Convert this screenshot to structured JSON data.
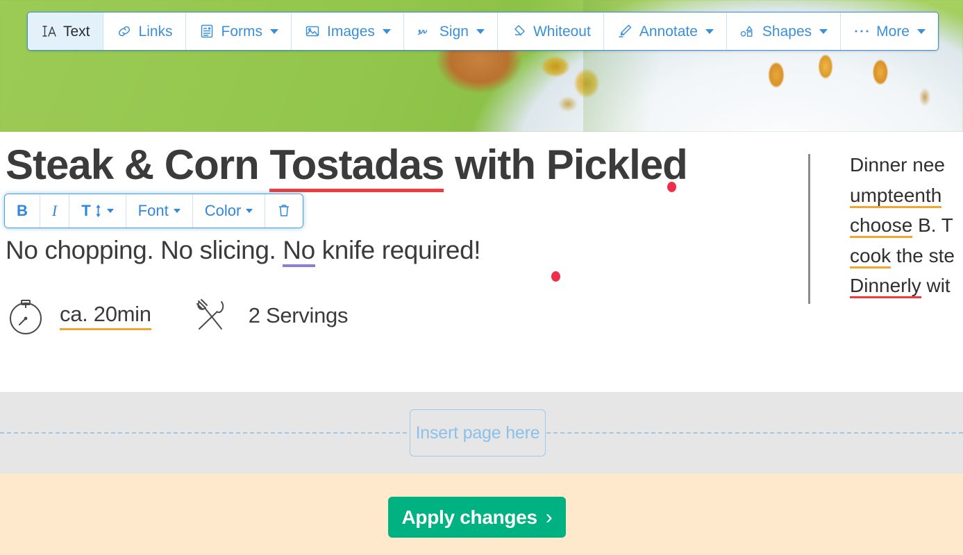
{
  "toolbar": {
    "items": [
      {
        "label": "Text",
        "icon": "text-cursor-icon",
        "active": true,
        "dropdown": false
      },
      {
        "label": "Links",
        "icon": "link-chain-icon",
        "active": false,
        "dropdown": false
      },
      {
        "label": "Forms",
        "icon": "form-clipboard-icon",
        "active": false,
        "dropdown": true
      },
      {
        "label": "Images",
        "icon": "image-picture-icon",
        "active": false,
        "dropdown": true
      },
      {
        "label": "Sign",
        "icon": "signature-icon",
        "active": false,
        "dropdown": true
      },
      {
        "label": "Whiteout",
        "icon": "eraser-icon",
        "active": false,
        "dropdown": false
      },
      {
        "label": "Annotate",
        "icon": "highlighter-pen-icon",
        "active": false,
        "dropdown": true
      },
      {
        "label": "Shapes",
        "icon": "shapes-icon",
        "active": false,
        "dropdown": true
      },
      {
        "label": "More",
        "icon": "ellipsis-icon",
        "active": false,
        "dropdown": true
      }
    ]
  },
  "format_toolbar": {
    "bold_label": "B",
    "italic_label": "I",
    "text_size_label": "T",
    "font_label": "Font",
    "color_label": "Color",
    "delete_icon": "trash-icon"
  },
  "document": {
    "title_part1": "Steak & Corn ",
    "title_misspelled": "Tostadas",
    "title_part2": " with Pickled",
    "subtitle_part1": "No chopping. No slicing. ",
    "subtitle_flagged": "No",
    "subtitle_part2": " knife required!",
    "meta": {
      "time_icon": "stopwatch-icon",
      "time_value": "ca. 20min",
      "servings_icon": "fork-knife-icon",
      "servings_value": "2 Servings"
    },
    "side_column": [
      {
        "plain_before": "Dinner nee",
        "flagged": "",
        "flag_color": "",
        "plain_after": ""
      },
      {
        "plain_before": "",
        "flagged": "umpteenth",
        "flag_color": "orange",
        "plain_after": " "
      },
      {
        "plain_before": "",
        "flagged": "choose",
        "flag_color": "orange",
        "plain_after": " B. T"
      },
      {
        "plain_before": "",
        "flagged": "cook",
        "flag_color": "orange",
        "plain_after": " the ste"
      },
      {
        "plain_before": "",
        "flagged": "Dinnerly",
        "flag_color": "red",
        "plain_after": " wit"
      }
    ]
  },
  "insert_band": {
    "button_label": "Insert page here"
  },
  "footer": {
    "apply_label": "Apply changes",
    "apply_chevron": "›"
  },
  "colors": {
    "accent_blue": "#3a8fd9",
    "active_tab_bg": "#e3f1fb",
    "apply_green": "#00b282",
    "footer_cream": "#ffe9cd",
    "insert_gray": "#e6e6e6",
    "spell_red": "#ef3b3b",
    "spell_orange": "#f0a732",
    "spell_purple": "#8a7de0",
    "marker_red": "#ef2f4a"
  }
}
